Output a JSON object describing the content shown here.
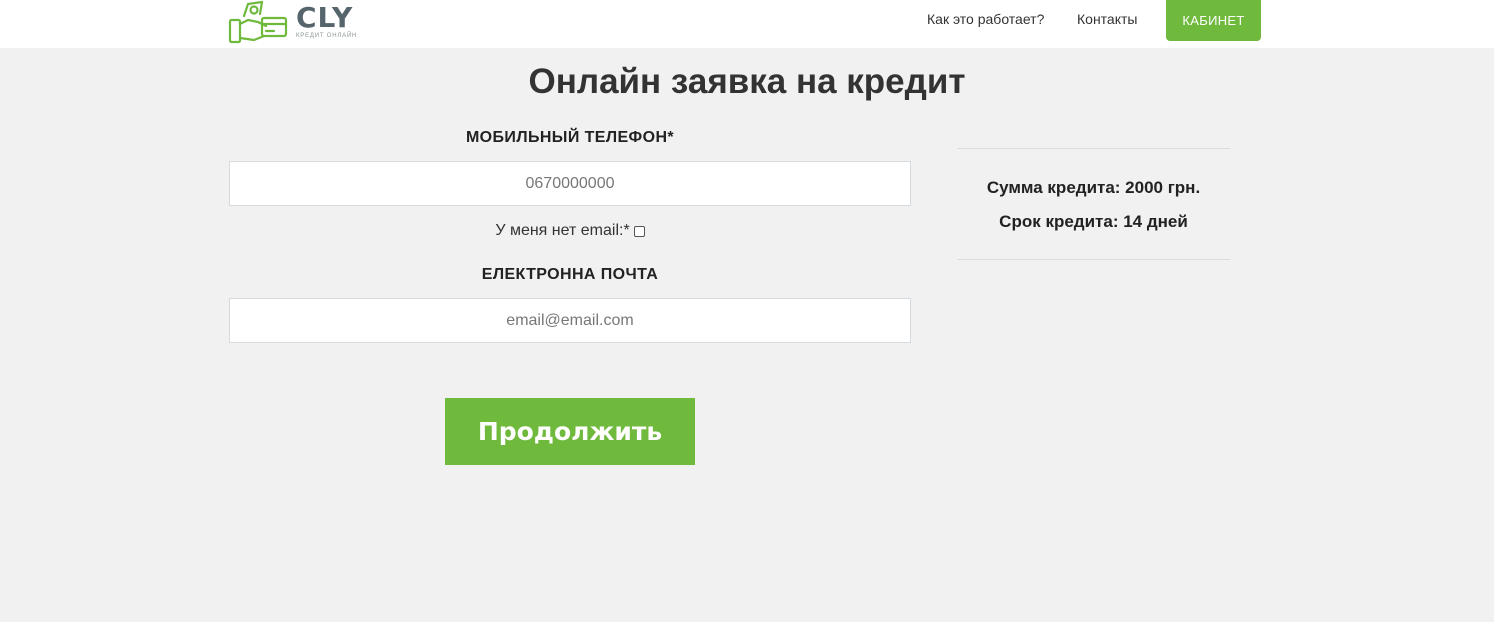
{
  "colors": {
    "accent": "#6fb93d",
    "logo_text": "#55656b",
    "background": "#f1f1f1",
    "header_bg": "#ffffff"
  },
  "header": {
    "logo": {
      "text": "CLY",
      "subtitle": "КРЕДИТ ОНЛАЙН",
      "icon": "money-hand-card-icon"
    },
    "nav": {
      "how_it_works": "Как это работает?",
      "contacts": "Контакты",
      "cabinet": "КАБИНЕТ"
    }
  },
  "main": {
    "title": "Онлайн заявка на кредит",
    "form": {
      "phone_label": "МОБИЛЬНЫЙ ТЕЛЕФОН*",
      "phone_placeholder": "0670000000",
      "phone_value": "",
      "no_email_label": "У меня нет email:*",
      "no_email_checked": false,
      "email_label": "ЕЛЕКТРОННА ПОЧТА",
      "email_placeholder": "email@email.com",
      "email_value": "",
      "submit_label": "Продолжить"
    },
    "summary": {
      "amount": "Сумма кредита: 2000 грн.",
      "term": "Срок кредита: 14 дней"
    }
  }
}
